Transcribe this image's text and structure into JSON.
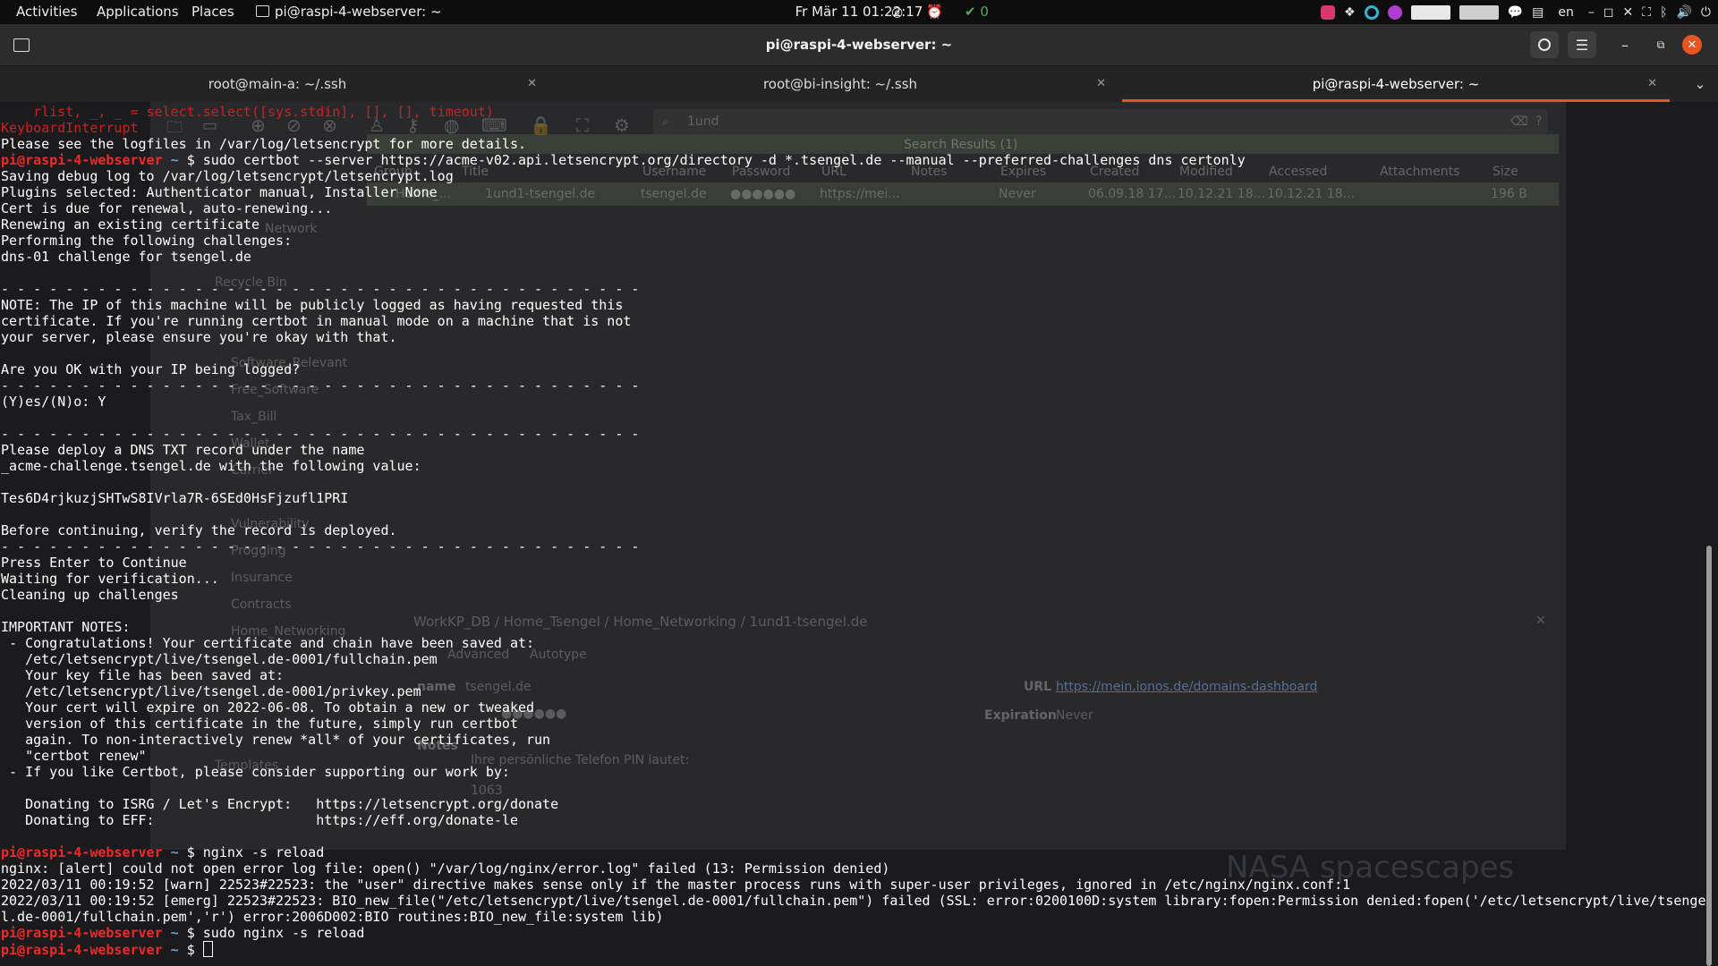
{
  "topbar": {
    "activities": "Activities",
    "applications": "Applications",
    "places": "Places",
    "window_label": "pi@raspi-4-webserver: ~",
    "clock": "Fr Mär 11  01:22:17",
    "check_count": "0",
    "language": "en"
  },
  "window": {
    "title": "pi@raspi-4-webserver: ~"
  },
  "tabs": [
    {
      "label": "root@main-a: ~/.ssh"
    },
    {
      "label": "root@bi-insight: ~/.ssh"
    },
    {
      "label": "pi@raspi-4-webserver: ~"
    }
  ],
  "ghost": {
    "search_value": "1und",
    "search_results": "Search Results (1)",
    "columns": [
      "Group",
      "Title",
      "Username",
      "Password",
      "URL",
      "Notes",
      "Expires",
      "Created",
      "Modified",
      "Accessed",
      "Attachments",
      "Size"
    ],
    "row": {
      "group": "Home_...",
      "title": "1und1-tsengel.de",
      "username": "tsengel.de",
      "password": "●●●●●●",
      "url": "https://mei...",
      "expires": "Never",
      "created": "06.09.18 17...",
      "modified": "10.12.21 18...",
      "accessed": "10.12.21 18...",
      "size": "196 B"
    },
    "groups": [
      "Network",
      "Recycle Bin",
      "Software_Relevant",
      "Free_Software",
      "Tax_Bill",
      "Wallet",
      "Carrier",
      "Vulnerability",
      "Progging",
      "Insurance",
      "Contracts",
      "Home_Networking",
      "Templates"
    ],
    "breadcrumb": "WorkKP_DB / Home_Tsengel / Home_Networking / 1und1-tsengel.de",
    "tab_advanced": "Advanced",
    "tab_autotype": "Autotype",
    "username_label": "name",
    "username_value": "tsengel.de",
    "url_label": "URL",
    "url_value": "https://mein.ionos.de/domains-dashboard",
    "expiration_label": "Expiration",
    "expiration_value": "Never",
    "notes_label": "Notes",
    "notes_line1": "Ihre persönliche Telefon PIN lautet:",
    "notes_line2": "1063",
    "watermark": "NASA spacescapes"
  },
  "terminal": {
    "prompt_user": "pi@raspi-4-webserver",
    "prompt_path": " ~ ",
    "prompt_symbol": "$ ",
    "lines": [
      "    rlist, _, _ = select.select([sys.stdin], [], [], timeout)",
      "KeyboardInterrupt",
      "Please see the logfiles in /var/log/letsencrypt for more details.",
      "sudo certbot --server https://acme-v02.api.letsencrypt.org/directory -d *.tsengel.de --manual --preferred-challenges dns certonly",
      "Saving debug log to /var/log/letsencrypt/letsencrypt.log",
      "Plugins selected: Authenticator manual, Installer None",
      "Cert is due for renewal, auto-renewing...",
      "Renewing an existing certificate",
      "Performing the following challenges:",
      "dns-01 challenge for tsengel.de",
      "",
      "- - - - - - - - - - - - - - - - - - - - - - - - - - - - - - - - - - - - - - - -",
      "NOTE: The IP of this machine will be publicly logged as having requested this",
      "certificate. If you're running certbot in manual mode on a machine that is not",
      "your server, please ensure you're okay with that.",
      "",
      "Are you OK with your IP being logged?",
      "- - - - - - - - - - - - - - - - - - - - - - - - - - - - - - - - - - - - - - - -",
      "(Y)es/(N)o: Y",
      "",
      "- - - - - - - - - - - - - - - - - - - - - - - - - - - - - - - - - - - - - - - -",
      "Please deploy a DNS TXT record under the name",
      "_acme-challenge.tsengel.de with the following value:",
      "",
      "Tes6D4rjkuzjSHTwS8IVrla7R-6SEd0HsFjzufl1PRI",
      "",
      "Before continuing, verify the record is deployed.",
      "- - - - - - - - - - - - - - - - - - - - - - - - - - - - - - - - - - - - - - - -",
      "Press Enter to Continue",
      "Waiting for verification...",
      "Cleaning up challenges",
      "",
      "IMPORTANT NOTES:",
      " - Congratulations! Your certificate and chain have been saved at:",
      "   /etc/letsencrypt/live/tsengel.de-0001/fullchain.pem",
      "   Your key file has been saved at:",
      "   /etc/letsencrypt/live/tsengel.de-0001/privkey.pem",
      "   Your cert will expire on 2022-06-08. To obtain a new or tweaked",
      "   version of this certificate in the future, simply run certbot",
      "   again. To non-interactively renew *all* of your certificates, run",
      "   \"certbot renew\"",
      " - If you like Certbot, please consider supporting our work by:",
      "",
      "   Donating to ISRG / Let's Encrypt:   https://letsencrypt.org/donate",
      "   Donating to EFF:                    https://eff.org/donate-le",
      "",
      "nginx -s reload",
      "nginx: [alert] could not open error log file: open() \"/var/log/nginx/error.log\" failed (13: Permission denied)",
      "2022/03/11 00:19:52 [warn] 22523#22523: the \"user\" directive makes sense only if the master process runs with super-user privileges, ignored in /etc/nginx/nginx.conf:1",
      "2022/03/11 00:19:52 [emerg] 22523#22523: BIO_new_file(\"/etc/letsencrypt/live/tsengel.de-0001/fullchain.pem\") failed (SSL: error:0200100D:system library:fopen:Permission denied:fopen('/etc/letsencrypt/live/tsenge",
      "l.de-0001/fullchain.pem','r') error:2006D002:BIO routines:BIO_new_file:system lib)",
      "sudo nginx -s reload",
      ""
    ]
  },
  "colors": {
    "prompt_user": "#ef2929",
    "prompt_path": "#729fcf",
    "tab_accent": "#e95420",
    "close_button": "#e95420",
    "terminal_bg": "#1b1b1e"
  }
}
